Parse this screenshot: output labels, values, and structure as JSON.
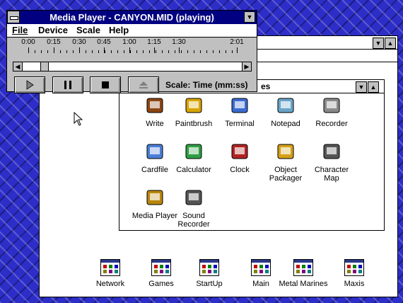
{
  "colors": {
    "desktop": "#2d2dc8",
    "title_active": "#000080",
    "window_face": "#c0c0c0"
  },
  "media_player": {
    "title": "Media Player - CANYON.MID (playing)",
    "menu": [
      "File",
      "Device",
      "Scale",
      "Help"
    ],
    "scale_ticks": [
      "0:00",
      "0:15",
      "0:30",
      "0:45",
      "1:00",
      "1:15",
      "1:30",
      "2:01"
    ],
    "position_fraction": 0.08,
    "buttons": [
      {
        "name": "play-button",
        "icon": "play-icon"
      },
      {
        "name": "pause-button",
        "icon": "pause-icon"
      },
      {
        "name": "stop-button",
        "icon": "stop-icon"
      },
      {
        "name": "eject-button",
        "icon": "eject-icon"
      }
    ],
    "scale_label": "Scale: Time (mm:ss)"
  },
  "accessories": {
    "title_partial": "es",
    "icons": [
      {
        "label": "Write",
        "icon": "write-icon"
      },
      {
        "label": "Paintbrush",
        "icon": "paintbrush-icon"
      },
      {
        "label": "Terminal",
        "icon": "terminal-icon"
      },
      {
        "label": "Notepad",
        "icon": "notepad-icon"
      },
      {
        "label": "Recorder",
        "icon": "recorder-icon"
      },
      {
        "label": "Cardfile",
        "icon": "cardfile-icon"
      },
      {
        "label": "Calculator",
        "icon": "calculator-icon"
      },
      {
        "label": "Clock",
        "icon": "clock-icon"
      },
      {
        "label": "Object Packager",
        "icon": "object-packager-icon"
      },
      {
        "label": "Character Map",
        "icon": "character-map-icon"
      },
      {
        "label": "Media Player",
        "icon": "media-player-icon"
      },
      {
        "label": "Sound Recorder",
        "icon": "sound-recorder-icon"
      }
    ]
  },
  "program_groups": [
    "Network",
    "Games",
    "StartUp",
    "Main",
    "Metal Marines",
    "Maxis"
  ]
}
